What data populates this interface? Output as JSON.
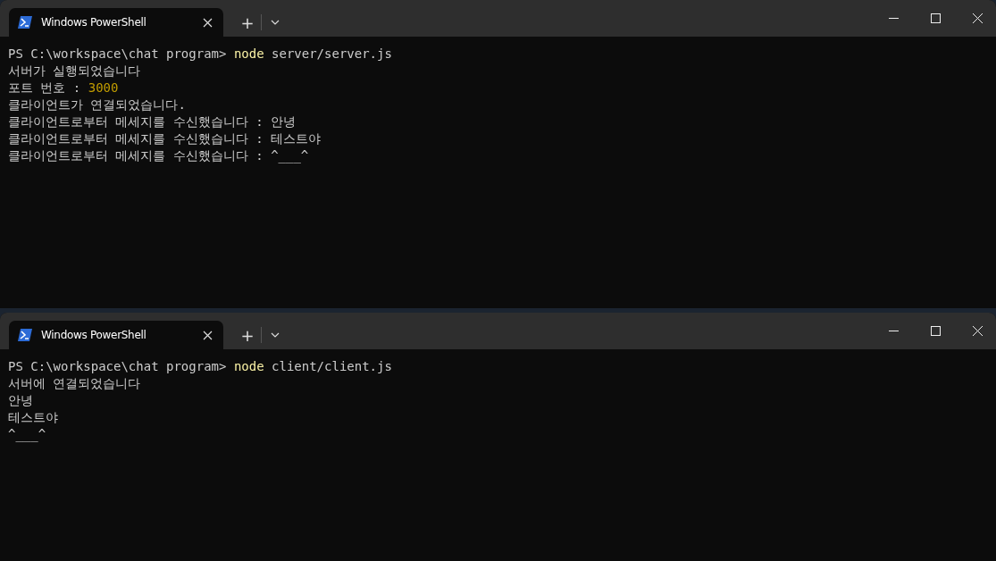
{
  "windows": [
    {
      "tabs": [
        {
          "title": "Windows PowerShell",
          "selected": true
        }
      ],
      "new_tab": "+",
      "lines": [
        [
          {
            "kind": "prompt",
            "text": "PS C:\\workspace\\chat program> "
          },
          {
            "kind": "command",
            "text": "node"
          },
          {
            "kind": "output",
            "text": " server/server.js"
          }
        ],
        [
          {
            "kind": "output",
            "text": "서버가 실행되었습니다"
          }
        ],
        [
          {
            "kind": "output",
            "text": "포트 번호 : "
          },
          {
            "kind": "number",
            "text": "3000"
          }
        ],
        [
          {
            "kind": "output",
            "text": "클라이언트가 연결되었습니다."
          }
        ],
        [
          {
            "kind": "output",
            "text": "클라이언트로부터 메세지를 수신했습니다 : 안녕"
          }
        ],
        [
          {
            "kind": "output",
            "text": "클라이언트로부터 메세지를 수신했습니다 : 테스트야"
          }
        ],
        [
          {
            "kind": "output",
            "text": "클라이언트로부터 메세지를 수신했습니다 : ^___^"
          }
        ]
      ]
    },
    {
      "tabs": [
        {
          "title": "Windows PowerShell",
          "selected": true
        }
      ],
      "new_tab": "+",
      "lines": [
        [
          {
            "kind": "prompt",
            "text": "PS C:\\workspace\\chat program> "
          },
          {
            "kind": "command",
            "text": "node"
          },
          {
            "kind": "output",
            "text": " client/client.js"
          }
        ],
        [
          {
            "kind": "output",
            "text": "서버에 연결되었습니다"
          }
        ],
        [
          {
            "kind": "output",
            "text": "안녕"
          }
        ],
        [
          {
            "kind": "output",
            "text": "테스트야"
          }
        ],
        [
          {
            "kind": "output",
            "text": "^___^"
          }
        ]
      ]
    }
  ]
}
